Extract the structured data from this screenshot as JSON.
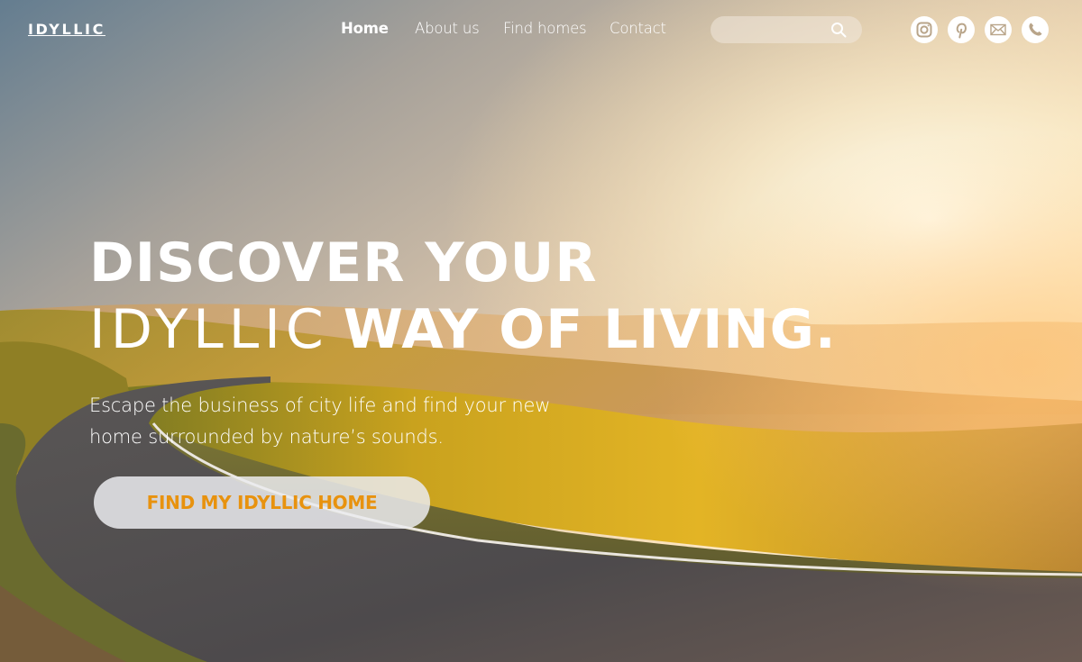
{
  "brand": {
    "logo_text": "IDYLLIC"
  },
  "nav": {
    "items": [
      {
        "label": "Home",
        "active": true
      },
      {
        "label": "About us",
        "active": false
      },
      {
        "label": "Find homes",
        "active": false
      },
      {
        "label": "Contact",
        "active": false
      }
    ]
  },
  "search": {
    "value": "",
    "placeholder": "",
    "icon": "search-icon"
  },
  "socials": [
    {
      "name": "instagram",
      "icon": "instagram-icon"
    },
    {
      "name": "pinterest",
      "icon": "pinterest-icon"
    },
    {
      "name": "email",
      "icon": "mail-icon"
    },
    {
      "name": "phone",
      "icon": "phone-icon"
    }
  ],
  "hero": {
    "title_line1": "DISCOVER YOUR",
    "title_brand": "IDYLLIC",
    "title_line2_rest": "WAY OF LIVING.",
    "subtitle": "Escape the business of city life and find your new home surrounded by nature’s sounds.",
    "cta_label": "FIND MY IDYLLIC HOME"
  },
  "colors": {
    "accent": "#e8920e",
    "text_on_image": "#ffffff",
    "button_bg": "#ebebee"
  }
}
